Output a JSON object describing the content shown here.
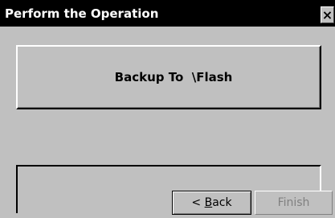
{
  "window": {
    "title": "Perform the Operation",
    "close_label": "×"
  },
  "action": {
    "label": "Backup To  \\Flash"
  },
  "progress": {
    "percent": 0
  },
  "buttons": {
    "back": {
      "prefix": "< ",
      "mnemonic": "B",
      "rest": "ack"
    },
    "finish": {
      "label": "Finish",
      "enabled": false
    }
  },
  "colors": {
    "face": "#c0c0c0",
    "titlebar": "#000000",
    "disabled_text": "#808080"
  }
}
